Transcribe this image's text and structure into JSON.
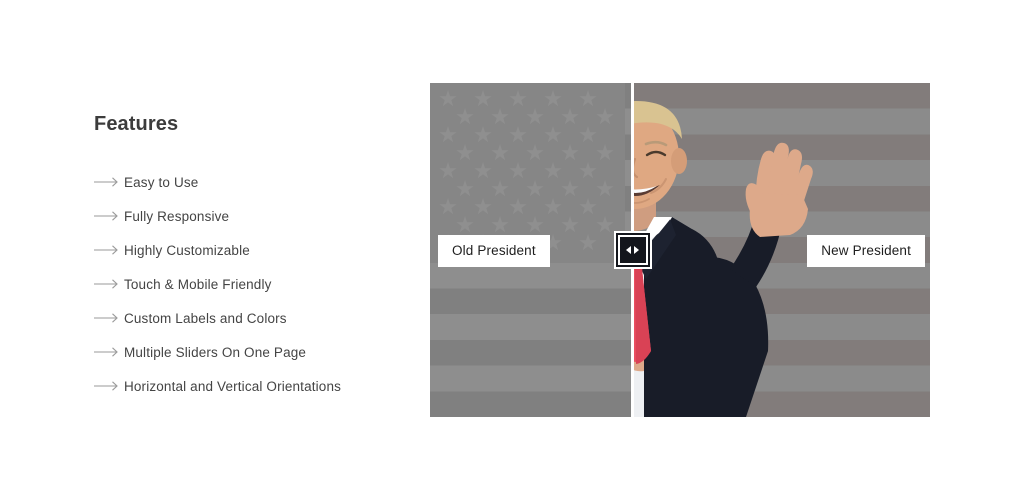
{
  "features": {
    "title": "Features",
    "arrow_icon": "arrow-right-icon",
    "items": [
      {
        "label": "Easy to Use"
      },
      {
        "label": "Fully Responsive"
      },
      {
        "label": "Highly Customizable"
      },
      {
        "label": "Touch & Mobile Friendly"
      },
      {
        "label": "Custom Labels and Colors"
      },
      {
        "label": "Multiple Sliders On One Page"
      },
      {
        "label": "Horizontal and Vertical Orientations"
      }
    ]
  },
  "comparison_slider": {
    "before_label": "Old President",
    "after_label": "New President",
    "handle_icon_left": "triangle-left-icon",
    "handle_icon_right": "triangle-right-icon",
    "orientation": "horizontal",
    "divider_position_percent": 40,
    "colors": {
      "divider": "#ffffff",
      "handle_background": "#14161c",
      "handle_border": "#ffffff",
      "label_background": "#ffffff",
      "label_text": "#1e1e1e",
      "flag_stripe_dark": "#827c7b",
      "flag_stripe_light": "#8b8b8b",
      "flag_canton": "#868382",
      "tie": "#e8485a",
      "suit": "#181c28",
      "skin": "#dca98a",
      "hair": "#d8c08c"
    }
  }
}
